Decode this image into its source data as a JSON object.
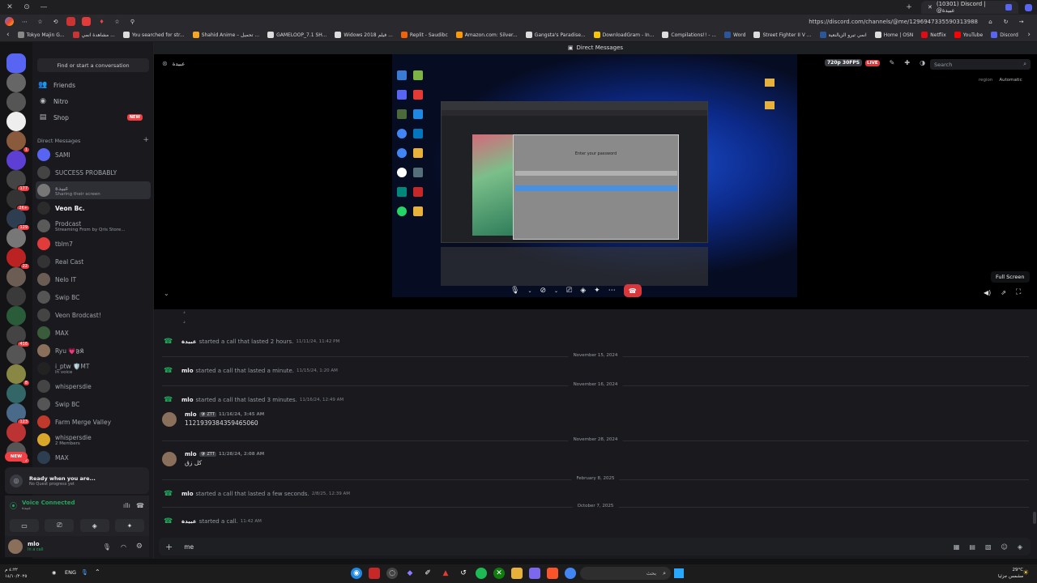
{
  "browser": {
    "tab_title": "(10301) Discord | @عبيدة",
    "url": "https://discord.com/channels/@me/1296947335590313988",
    "bookmarks": [
      {
        "label": "Tokyo Majin G...",
        "color": "#888"
      },
      {
        "label": "مشاهدة انمي ...",
        "color": "#c33"
      },
      {
        "label": "You searched for str...",
        "color": "#ddd"
      },
      {
        "label": "Shahid Anime – تحميل ...",
        "color": "#f5a623"
      },
      {
        "label": "GAMELOOP_7.1 SH...",
        "color": "#ddd"
      },
      {
        "label": "Widows 2018 فيلم ...",
        "color": "#ddd"
      },
      {
        "label": "Replit - Saudibc",
        "color": "#f26207"
      },
      {
        "label": "Amazon.com: Silver...",
        "color": "#ff9900"
      },
      {
        "label": "Gangsta's Paradise...",
        "color": "#ddd"
      },
      {
        "label": "DownloadGram - In...",
        "color": "#f7c600"
      },
      {
        "label": "Compilations!! - ...",
        "color": "#ddd"
      },
      {
        "label": "Word",
        "color": "#2b579a"
      },
      {
        "label": "Street Fighter II V ...",
        "color": "#ddd"
      },
      {
        "label": "انمي تيرو الزيالنعية",
        "color": "#2b579a"
      },
      {
        "label": "Home | OSN",
        "color": "#ddd"
      },
      {
        "label": "Netflix",
        "color": "#e50914"
      },
      {
        "label": "YouTube",
        "color": "#ff0000"
      },
      {
        "label": "Discord",
        "color": "#5865f2"
      }
    ]
  },
  "sidebar": {
    "find_placeholder": "Find or start a conversation",
    "nav": [
      {
        "label": "Friends",
        "icon": "friends-icon",
        "glyph": "👥"
      },
      {
        "label": "Nitro",
        "icon": "nitro-icon",
        "glyph": "◉"
      },
      {
        "label": "Shop",
        "icon": "shop-icon",
        "glyph": "▤",
        "badge": "NEW"
      }
    ],
    "dm_header": "Direct Messages",
    "dms": [
      {
        "name": "SAMI",
        "sub": "",
        "bold": false,
        "color": "#5865f2"
      },
      {
        "name": "SUCCESS PROBABLY",
        "sub": "",
        "bold": false,
        "color": "#444"
      },
      {
        "name": "عبيدة",
        "sub": "Sharing their screen",
        "bold": false,
        "color": "#777",
        "selected": true
      },
      {
        "name": "Veon Bc.",
        "sub": "",
        "bold": true,
        "color": "#2b2b2b"
      },
      {
        "name": "Prodcast",
        "sub": "Streaming From by Qris Store...",
        "bold": false,
        "color": "#5a5a5a"
      },
      {
        "name": "tblm7",
        "sub": "",
        "bold": false,
        "color": "#e23b3b"
      },
      {
        "name": "Real Cast",
        "sub": "",
        "bold": false,
        "color": "#333"
      },
      {
        "name": "Nelo IT",
        "sub": "",
        "bold": false,
        "color": "#6b5d54"
      },
      {
        "name": "Swip BC",
        "sub": "",
        "bold": false,
        "color": "#555"
      },
      {
        "name": "Veon Brodcast!",
        "sub": "",
        "bold": false,
        "color": "#444"
      },
      {
        "name": "MAX",
        "sub": "",
        "bold": false,
        "color": "#3a5c3a"
      },
      {
        "name": "Ryu 💗𝕱𝕶",
        "sub": "",
        "bold": false,
        "color": "#8a6f5a"
      },
      {
        "name": "i_ptw 🛡️MT",
        "sub": "In voice",
        "bold": false,
        "color": "#222"
      },
      {
        "name": "whispersdie",
        "sub": "",
        "bold": false,
        "color": "#444"
      },
      {
        "name": "Swip BC",
        "sub": "",
        "bold": false,
        "color": "#555"
      },
      {
        "name": "Farm Merge Valley",
        "sub": "",
        "bold": false,
        "color": "#c0392b"
      },
      {
        "name": "whispersdie",
        "sub": "2 Members",
        "bold": false,
        "color": "#d9a72a"
      },
      {
        "name": "MAX",
        "sub": "",
        "bold": false,
        "color": "#2c3e50"
      }
    ],
    "quest_title": "Ready when you are...",
    "quest_sub": "No Quest progress yet",
    "voice_status": "Voice Connected",
    "voice_channel": "عبيدة",
    "user_name": "mlo",
    "user_status": "In a call"
  },
  "guilds": [
    {
      "badge": "",
      "color": "#5865f2"
    },
    {
      "badge": "",
      "color": "#666"
    },
    {
      "badge": "",
      "color": "#555"
    },
    {
      "badge": "",
      "color": "#eee"
    },
    {
      "badge": "1",
      "color": "#8a5a3c"
    },
    {
      "badge": "",
      "color": "#5d3fd3"
    },
    {
      "badge": "177",
      "color": "#444"
    },
    {
      "badge": "2K+",
      "color": "#333"
    },
    {
      "badge": "129",
      "color": "#2d3e50"
    },
    {
      "badge": "",
      "color": "#777"
    },
    {
      "badge": "22",
      "color": "#b22"
    },
    {
      "badge": "",
      "color": "#6b5d54"
    },
    {
      "badge": "",
      "color": "#3a3a3a"
    },
    {
      "badge": "",
      "color": "#2a5c3a"
    },
    {
      "badge": "416",
      "color": "#444"
    },
    {
      "badge": "",
      "color": "#555"
    },
    {
      "badge": "8",
      "color": "#884"
    },
    {
      "badge": "",
      "color": "#366"
    },
    {
      "badge": "123",
      "color": "#4a6a8a"
    },
    {
      "badge": "",
      "color": "#b33"
    },
    {
      "badge": "92",
      "color": "#555"
    }
  ],
  "guild_new": "NEW",
  "main": {
    "topbar_title": "Direct Messages",
    "header_name": "عبيدة",
    "stream_quality": "720p 30FPS",
    "live_label": "LIVE",
    "search_placeholder": "Search",
    "region_label": "region",
    "region_value": "Automatic",
    "fullscreen_tooltip": "Full Screen",
    "streamed_window_title": "Enter your password",
    "messages": [
      {
        "type": "sys",
        "author": "عبيدة",
        "text": "started a call that lasted 2 hours.",
        "time": "11/11/24, 11:42 PM"
      },
      {
        "type": "div",
        "text": "November 15, 2024"
      },
      {
        "type": "sys",
        "author": "mlo",
        "text": "started a call that lasted a minute.",
        "time": "11/15/24, 1:20 AM"
      },
      {
        "type": "div",
        "text": "November 16, 2024"
      },
      {
        "type": "sys",
        "author": "mlo",
        "text": "started a call that lasted 3 minutes.",
        "time": "11/16/24, 12:49 AM"
      },
      {
        "type": "msg",
        "author": "mlo",
        "tag": "🛡 ZTT",
        "time": "11/16/24, 3:45 AM",
        "body": "1121939384359465060"
      },
      {
        "type": "div",
        "text": "November 28, 2024"
      },
      {
        "type": "msg",
        "author": "mlo",
        "tag": "🛡 ZTT",
        "time": "11/28/24, 2:08 AM",
        "body": "كل زق"
      },
      {
        "type": "div",
        "text": "February 8, 2025"
      },
      {
        "type": "sys",
        "author": "mlo",
        "text": "started a call that lasted a few seconds.",
        "time": "2/8/25, 12:39 AM"
      },
      {
        "type": "div",
        "text": "October 7, 2025"
      },
      {
        "type": "sys",
        "author": "عبيدة",
        "text": "started a call.",
        "time": "11:42 AM"
      }
    ],
    "composer_text": "me"
  },
  "taskbar": {
    "time": "٤:٢٢ م",
    "date": "١٤/١٠/٢٠٢٥",
    "lang": "ENG",
    "search_placeholder": "بحث",
    "weather_temp": "29°C",
    "weather_desc": "مشمس جزئيا"
  },
  "colors": {
    "accent": "#5865f2",
    "danger": "#da373c",
    "online": "#23a55a"
  }
}
